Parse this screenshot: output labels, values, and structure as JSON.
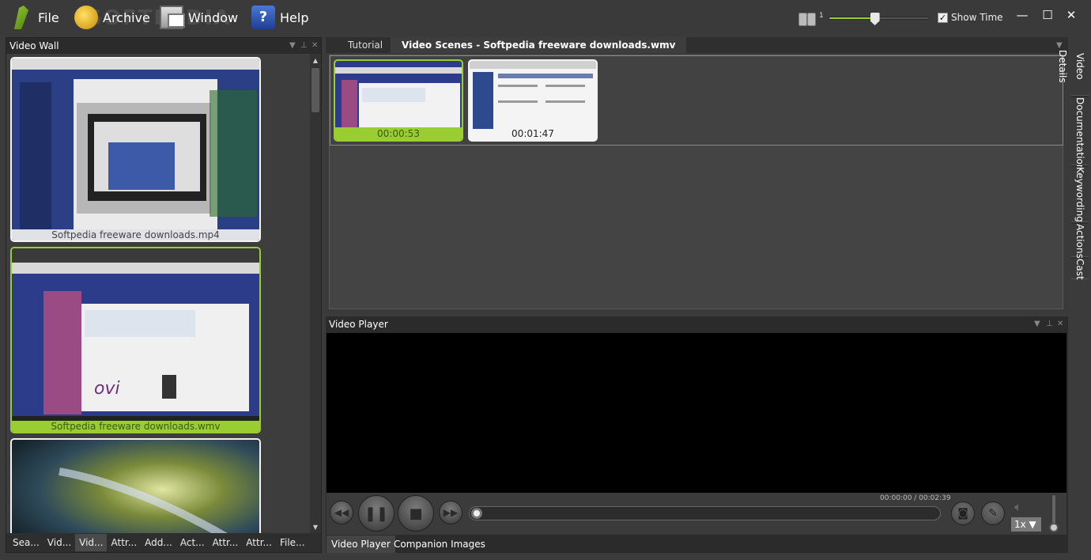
{
  "menu": {
    "file": "File",
    "archive": "Archive",
    "window": "Window",
    "help": "Help"
  },
  "watermark": "SOFTPEDIA",
  "toolbar": {
    "zoom_value": "1",
    "zoom_level": 0.45,
    "show_time_label": "Show Time",
    "show_time_checked": "✓",
    "minimize": "—",
    "maximize": "☐",
    "close": "✕"
  },
  "video_wall": {
    "title": "Video Wall",
    "items": [
      {
        "caption": "Softpedia freeware downloads.mp4"
      },
      {
        "caption": "Softpedia freeware downloads.wmv"
      },
      {
        "caption": ""
      }
    ],
    "bottom_tabs": [
      "Sea...",
      "Vid...",
      "Vid...",
      "Attr...",
      "Add...",
      "Act...",
      "Attr...",
      "Attr...",
      "File..."
    ],
    "active_tab_index": 2
  },
  "scenes": {
    "tabs": [
      "Tutorial",
      "Video Scenes - Softpedia freeware downloads.wmv"
    ],
    "items": [
      {
        "time": "00:00:53"
      },
      {
        "time": "00:01:47"
      }
    ]
  },
  "side_tabs": [
    "Video Details",
    "Documentation",
    "Keywording",
    "Actions",
    "Cast"
  ],
  "player": {
    "title": "Video Player",
    "time_readout": "00:00:00 / 00:02:39",
    "speed": "1x ▼",
    "tabs": [
      "Video Player",
      "Companion Images"
    ]
  },
  "colors": {
    "accent": "#9acd32",
    "background": "#3b3b3b"
  }
}
